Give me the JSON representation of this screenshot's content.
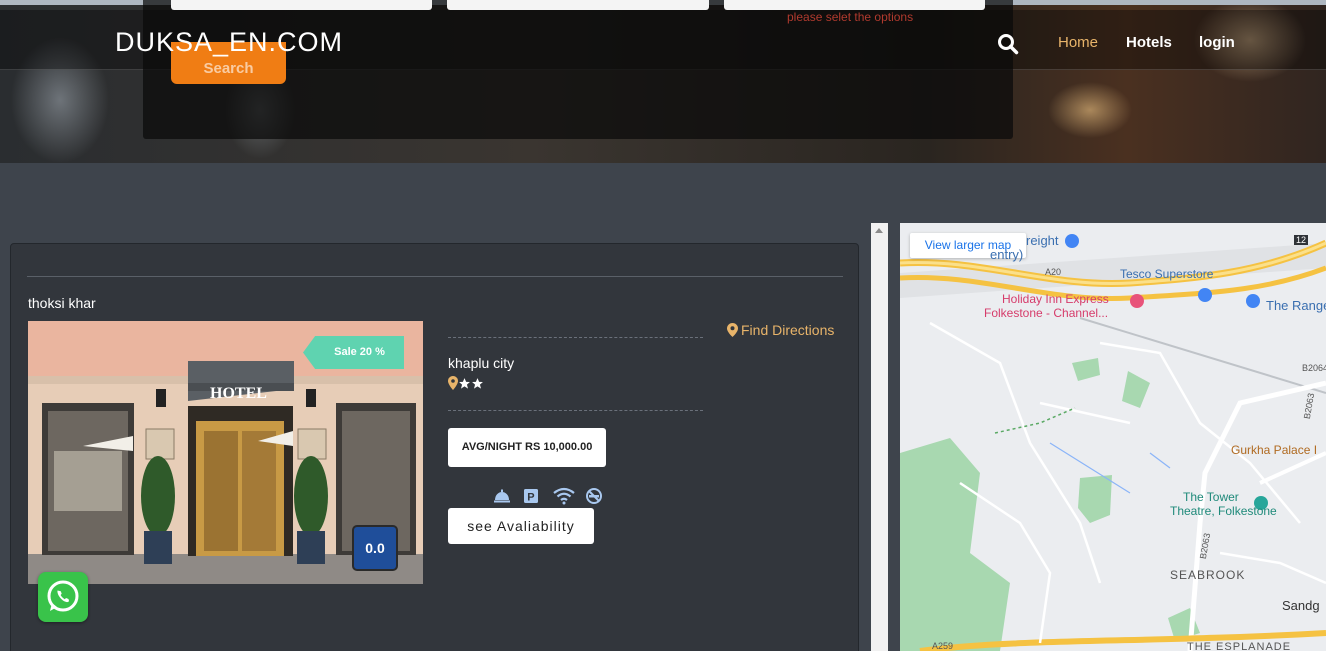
{
  "header": {
    "logo": "DUKSA_EN.COM",
    "nav": {
      "home": "Home",
      "hotels": "Hotels",
      "login": "login"
    },
    "search_icon": "search-icon"
  },
  "search": {
    "error": "please selet the options",
    "button": "Search"
  },
  "listing": {
    "name": "thoksi khar",
    "sale_badge": "Sale 20 %",
    "rating": "0.0",
    "find_directions": "Find Directions",
    "city": "khaplu city",
    "star_count": 2,
    "price": "AVG/NIGHT RS 10,000.00",
    "availability_button": "see Avaliability",
    "amenities": [
      "room-service-icon",
      "parking-icon",
      "wifi-icon",
      "no-smoking-icon"
    ],
    "photo_sign": "HOTEL"
  },
  "map": {
    "view_larger": "View larger map",
    "labels": {
      "freight": "reight",
      "entry": "entry)",
      "tesco": "Tesco Superstore",
      "holiday_inn_1": "Holiday Inn Express",
      "holiday_inn_2": "Folkestone - Channel...",
      "range": "The Range",
      "gurkha": "Gurkha Palace I",
      "tower_1": "The Tower",
      "tower_2": "Theatre, Folkestone",
      "seabrook": "SEABROOK",
      "sandgate": "Sandg",
      "esplanade": "THE ESPLANADE",
      "a20": "A20",
      "b2063": "B2063",
      "b2063b": "B2063",
      "b2064": "B2064",
      "a259": "A259",
      "road12": "12"
    }
  },
  "colors": {
    "accent_orange": "#f07d14",
    "link_gold": "#e8b46a",
    "sale_green": "#5fd3b0",
    "rating_blue": "#1f4e9a",
    "whatsapp_green": "#39c34a"
  }
}
